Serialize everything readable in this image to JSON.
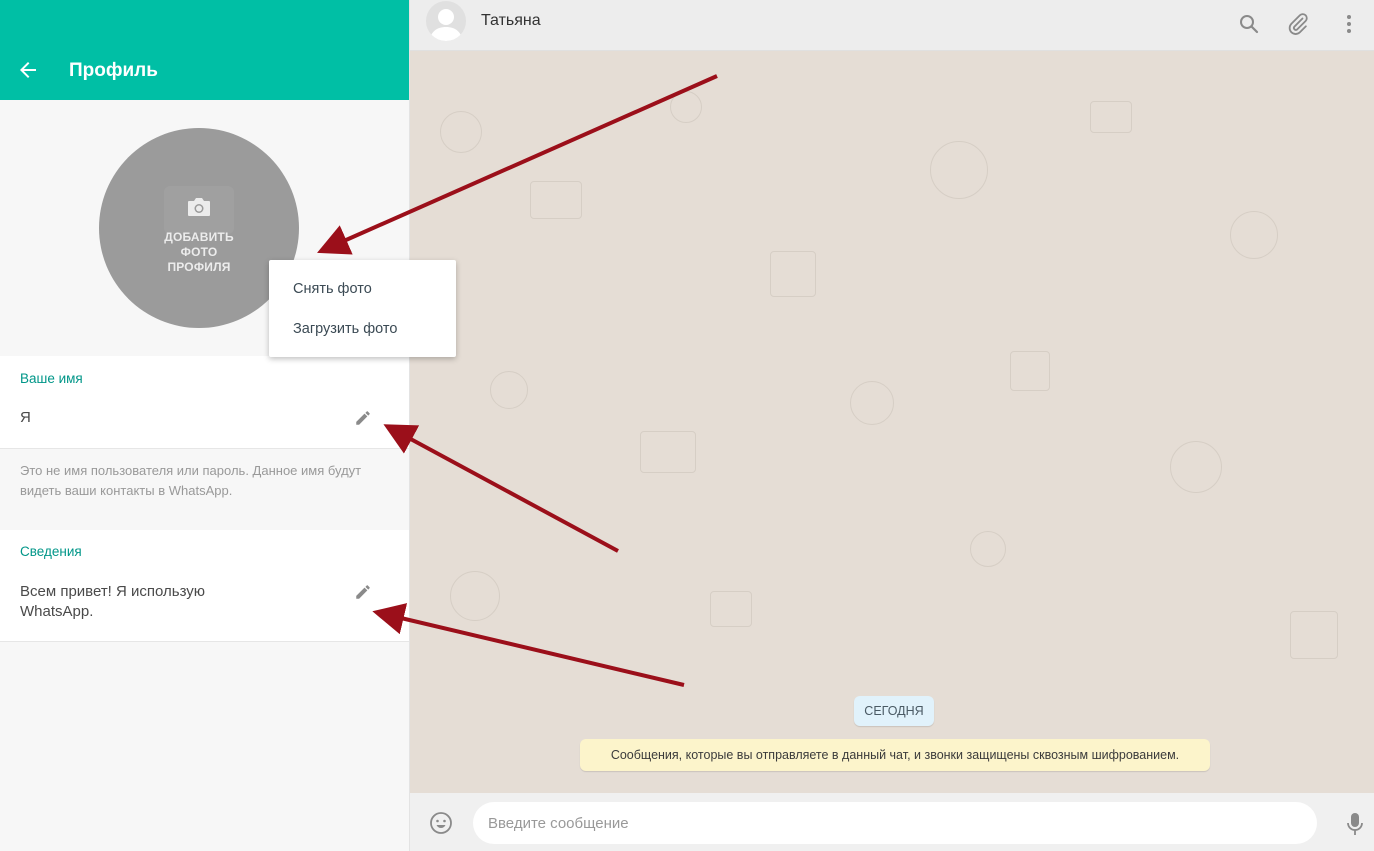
{
  "profile": {
    "title": "Профиль",
    "avatar_text": "ДОБАВИТЬ\nФОТО\nПРОФИЛЯ",
    "photo_menu": {
      "items": [
        "Снять фото",
        "Загрузить фото"
      ]
    },
    "name_section": {
      "label": "Ваше имя",
      "value": "Я",
      "note": "Это не имя пользователя или пароль. Данное имя будут видеть ваши контакты в WhatsApp."
    },
    "about_section": {
      "label": "Сведения",
      "value": "Всем привет! Я использую WhatsApp."
    }
  },
  "chat": {
    "contact_name": "Татьяна",
    "date_badge": "СЕГОДНЯ",
    "encryption_notice": "Сообщения, которые вы отправляете в данный чат, и звонки защищены сквозным шифрованием.",
    "input_placeholder": "Введите сообщение"
  },
  "colors": {
    "accent": "#00bfa5",
    "annotation_arrow": "#9b0f1a",
    "chat_background": "#e5ddd5",
    "notice_background": "#fcf4cb"
  },
  "icons": {
    "header": [
      "back-arrow-icon"
    ],
    "chat_header": [
      "search-icon",
      "paperclip-icon",
      "more-vertical-icon"
    ],
    "composer": [
      "emoji-icon",
      "microphone-icon"
    ],
    "profile": [
      "camera-icon",
      "pencil-icon"
    ]
  }
}
